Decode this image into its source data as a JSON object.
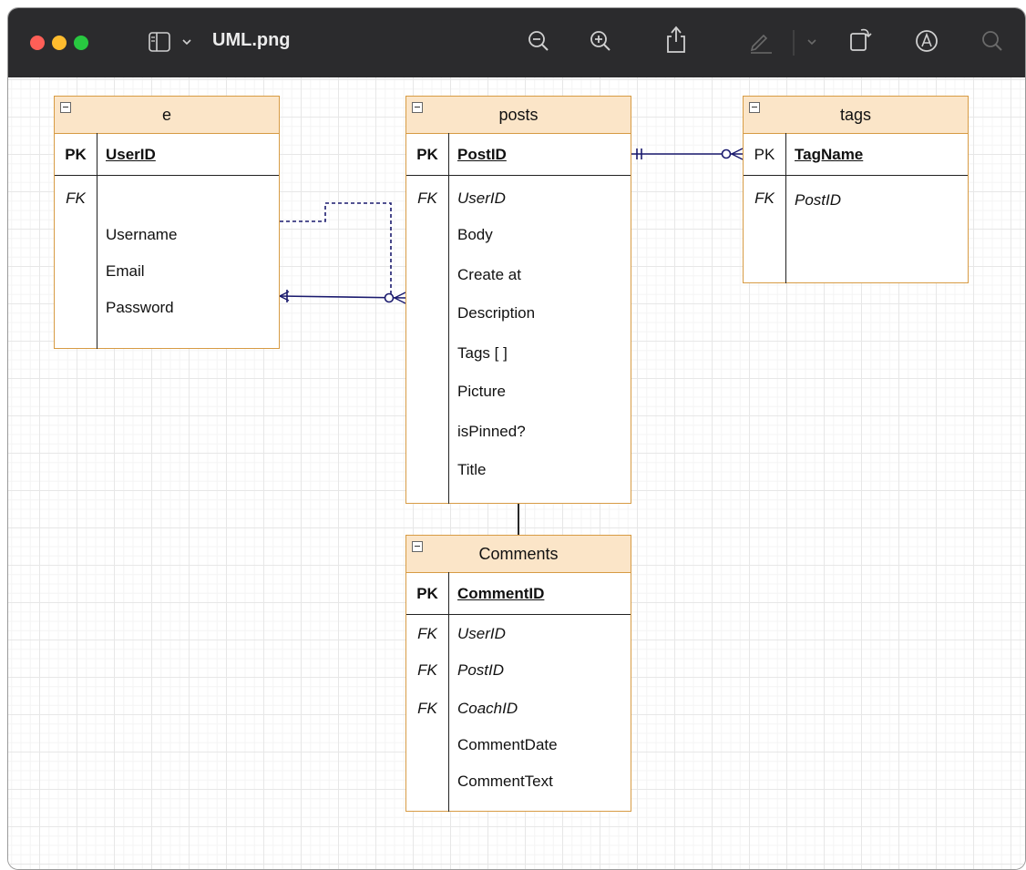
{
  "window": {
    "title": "UML.png"
  },
  "toolbar": {
    "icons": [
      "sidebar-icon",
      "chevron-down-icon",
      "zoom-out-icon",
      "zoom-in-icon",
      "share-icon",
      "markup-pen-icon",
      "chevron-down-icon",
      "rotate-icon",
      "annotate-icon",
      "search-icon"
    ]
  },
  "entities": {
    "e": {
      "title": "e",
      "pk_label": "PK",
      "pk_name": "UserID",
      "fk_labels": [
        "FK"
      ],
      "fields": [
        "Username",
        "Email",
        "Password"
      ]
    },
    "posts": {
      "title": "posts",
      "pk_label": "PK",
      "pk_name": "PostID",
      "fk_labels": [
        "FK"
      ],
      "fields": [
        "UserID",
        "Body",
        "Create at",
        "Description",
        "Tags [ ]",
        "Picture",
        "isPinned?",
        "Title"
      ]
    },
    "tags": {
      "title": "tags",
      "pk_label": "PK",
      "pk_name": "TagName",
      "fk_labels": [
        "FK"
      ],
      "fields": [
        "PostID"
      ]
    },
    "comments": {
      "title": "Comments",
      "pk_label": "PK",
      "pk_name": "CommentID",
      "fk_labels": [
        "FK",
        "FK",
        "FK"
      ],
      "fields": [
        "UserID",
        "PostID",
        "CoachID",
        "CommentDate",
        "CommentText"
      ]
    }
  },
  "colors": {
    "titlebar": "#2b2b2d",
    "entity_border": "#d79b44",
    "entity_header": "#fbe5c8",
    "link": "#1a1a6e"
  }
}
